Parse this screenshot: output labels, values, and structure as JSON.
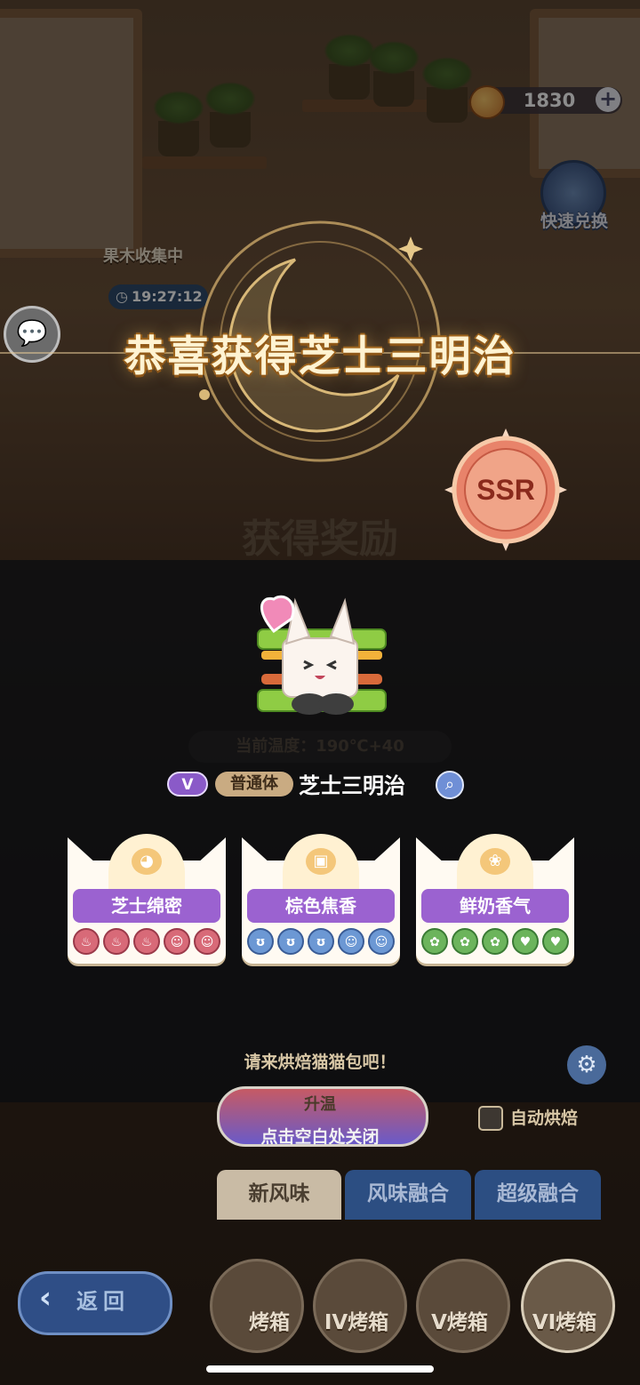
{
  "currency": {
    "value": "1830",
    "icon": "bread-coin-icon",
    "plus": "+"
  },
  "quick_exchange": {
    "label": "快速兑换"
  },
  "collect": {
    "label": "果木收集中",
    "timer": "19:27:12"
  },
  "popup": {
    "congrats": "恭喜获得芝士三明治",
    "rarity": "SSR",
    "rank": "V",
    "type": "普通体",
    "name": "芝士三明治",
    "traits": [
      {
        "label": "芝士绵密",
        "icon": "cat-face-icon",
        "color": "red"
      },
      {
        "label": "棕色焦香",
        "icon": "toast-icon",
        "color": "blue"
      },
      {
        "label": "鲜奶香气",
        "icon": "cream-icon",
        "color": "green"
      }
    ],
    "close_hint": "点击空白处关闭"
  },
  "background": {
    "rewards_title": "获得奖励",
    "temperature": "当前温度：190℃+40",
    "bake_prompt": "请来烘焙猫猫包吧！",
    "heat_button": "升温",
    "auto_bake": "自动烘焙",
    "tabs": [
      "新风味",
      "风味融合",
      "超级融合"
    ],
    "back": "返回",
    "ovens": [
      "烤箱",
      "IV烤箱",
      "V烤箱",
      "VI烤箱"
    ]
  },
  "colors": {
    "accent_purple": "#9b62d0",
    "card_bg": "#fffaf2",
    "gold_text": "#fff3d2"
  }
}
